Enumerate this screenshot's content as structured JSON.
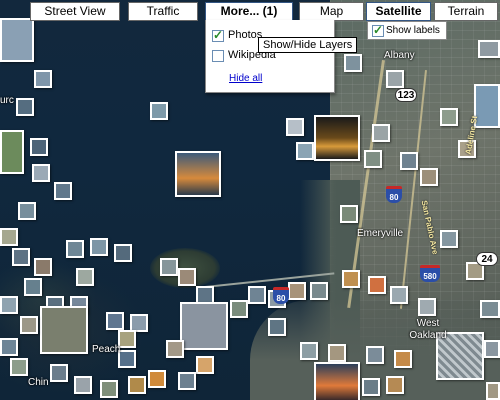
{
  "map_controls": {
    "street_view": "Street View",
    "traffic": "Traffic",
    "more": "More... (1)",
    "map": "Map",
    "satellite": "Satellite",
    "terrain": "Terrain",
    "active_map_type": "Satellite"
  },
  "more_panel": {
    "photos": {
      "label": "Photos",
      "checked": true
    },
    "wikipedia": {
      "label": "Wikipedia",
      "checked": false
    },
    "hide_all": "Hide all"
  },
  "tooltip": "Show/Hide Layers",
  "show_labels": {
    "label": "Show labels",
    "checked": true
  },
  "place_labels": {
    "emeryville": "Emeryville",
    "west_oakland": "West Oakland",
    "peach": "Peach",
    "chin": "Chin",
    "albany": "Albany",
    "fur": "urc"
  },
  "street_labels": {
    "san_pablo": "San Pablo Ave",
    "adeline": "Adeline St"
  },
  "route_shields": {
    "r123": "123",
    "r80a": "80",
    "r80b": "80",
    "r580": "580",
    "r24": "24"
  },
  "colors": {
    "water": "#10283e",
    "land": "#6e746a",
    "button_border_active": "#345684",
    "link": "#0000cc",
    "check": "#2a8a2a"
  },
  "icons": [
    "photo-thumbnail",
    "interstate-shield-icon",
    "route-shield-icon",
    "checkbox-icon"
  ]
}
